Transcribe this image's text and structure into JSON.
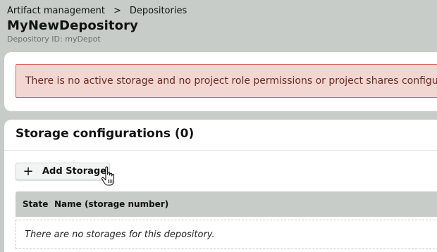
{
  "breadcrumb": {
    "items": [
      {
        "label": "Artifact management"
      },
      {
        "label": "Depositories"
      }
    ],
    "separator": ">"
  },
  "header": {
    "title": "MyNewDepository",
    "subtitle": "Depository ID: myDepot"
  },
  "alert": {
    "message": "There is no active storage and no project role permissions or project shares configured.",
    "level": "error",
    "background_color": "#f1d6d1",
    "border_color": "#d9665b"
  },
  "storage": {
    "title": "Storage configurations (0)",
    "add_button_label": "Add Storage",
    "add_button_icon": "plus-icon",
    "table": {
      "columns": [
        "State",
        "Name (storage number)"
      ],
      "rows": [],
      "empty_message": "There are no storages for this depository."
    }
  },
  "cursor": {
    "type": "hand-pointer-icon"
  },
  "colors": {
    "page_background": "#c7ccc9",
    "card_background": "#ffffff",
    "table_header_background": "#c7ccc9"
  }
}
